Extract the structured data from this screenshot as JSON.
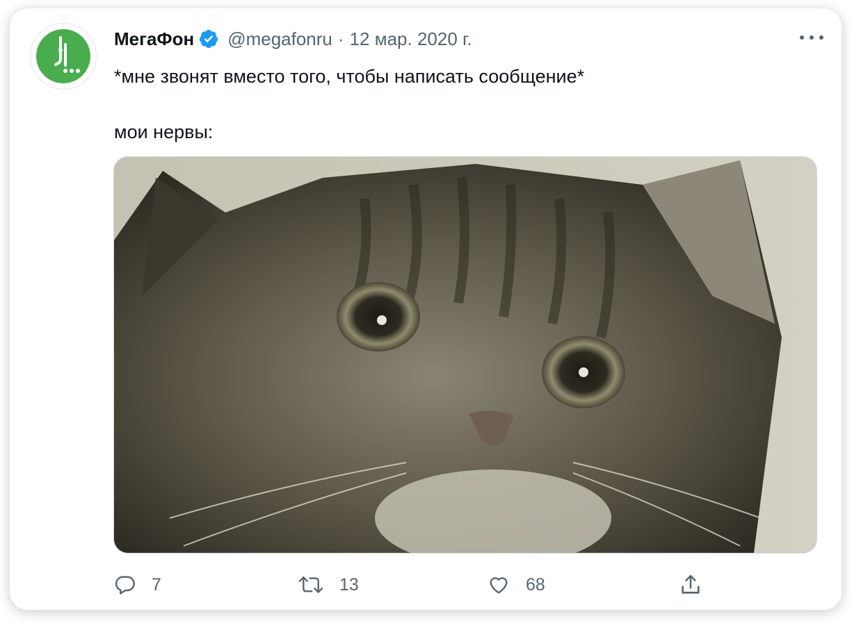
{
  "tweet": {
    "author_name": "МегаФон",
    "handle": "@megafonru",
    "separator": "·",
    "date": "12 мар. 2020 г.",
    "text_line_1": "*мне звонят вместо того, чтобы написать сообщение*",
    "text_line_2": "мои нервы:",
    "media_description_icon": "cat-photo"
  },
  "actions": {
    "reply_count": "7",
    "retweet_count": "13",
    "like_count": "68"
  },
  "colors": {
    "brand_green": "#49ad4f",
    "verified_blue": "#1d9bf0",
    "secondary_text": "#536471"
  }
}
